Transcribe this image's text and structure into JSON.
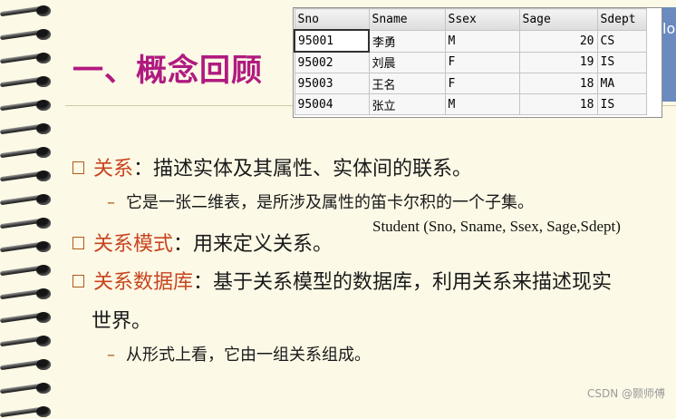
{
  "slide": {
    "title": "一、概念回顾",
    "bullets": [
      {
        "term": "关系",
        "rest": "：描述实体及其属性、实体间的联系。"
      },
      {
        "term": "关系模式",
        "rest": "：用来定义关系。"
      },
      {
        "term": "关系数据库",
        "rest": "：基于关系模型的数据库，利用关系来描述现实"
      }
    ],
    "bullet3_cont": "世界。",
    "sub1": "它是一张二维表，是所涉及属性的笛卡尔积的一个子集。",
    "sub2": "从形式上看，它由一组关系组成。",
    "schema": "Student (Sno, Sname, Ssex, Sage,Sdept)",
    "side_tab": "lo",
    "watermark": "CSDN @颢师傅"
  },
  "table": {
    "columns": [
      "Sno",
      "Sname",
      "Ssex",
      "Sage",
      "Sdept"
    ],
    "rows": [
      [
        "95001",
        "李勇",
        "M",
        "20",
        "CS"
      ],
      [
        "95002",
        "刘晨",
        "F",
        "19",
        "IS"
      ],
      [
        "95003",
        "王名",
        "F",
        "18",
        "MA"
      ],
      [
        "95004",
        "张立",
        "M",
        "18",
        "IS"
      ]
    ]
  }
}
